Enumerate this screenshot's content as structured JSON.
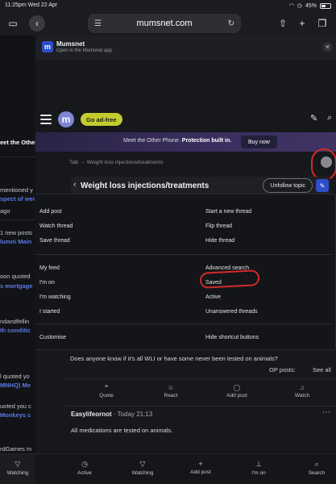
{
  "status_bar": {
    "time_date": "11:25pm  Wed 22 Apr",
    "battery": "45%"
  },
  "browser": {
    "url": "mumsnet.com"
  },
  "left_bg": {
    "fragments": [
      {
        "text": "eet the Other",
        "kind": "plain"
      },
      {
        "text": "mentioned y",
        "kind": "plain"
      },
      {
        "text": "spect of wei",
        "kind": "link"
      },
      {
        "text": "ago",
        "kind": "plain"
      },
      {
        "text": "1 new posts",
        "kind": "plain"
      },
      {
        "text": "lumni Main",
        "kind": "link"
      },
      {
        "text": "oon quoted",
        "kind": "plain"
      },
      {
        "text": "s mortgage",
        "kind": "link"
      },
      {
        "text": "ndandfellin",
        "kind": "plain"
      },
      {
        "text": "th conditic",
        "kind": "link"
      },
      {
        "text": "l quoted yo",
        "kind": "plain"
      },
      {
        "text": "MNHQ) Me",
        "kind": "link"
      },
      {
        "text": "uoted you c",
        "kind": "plain"
      },
      {
        "text": "Monkeys c",
        "kind": "link"
      },
      {
        "text": "rdGames m",
        "kind": "plain"
      }
    ],
    "bottom_label": "Watching"
  },
  "app_banner": {
    "title": "Mumsnet",
    "subtitle": "Open in the Mumsnet app"
  },
  "header": {
    "logo_letter": "m",
    "ad_free_label": "Go ad-free"
  },
  "promo": {
    "left_text": "eet the Other",
    "text": "Meet the Other Phone.",
    "bold_text": "Protection built in.",
    "button": "Buy now"
  },
  "breadcrumb": {
    "root": "Talk",
    "separator": "→",
    "current": "Weight loss injections/treatments"
  },
  "thread": {
    "title": "Weight loss injections/treatments",
    "unfollow_label": "Unfollow topic"
  },
  "menu": {
    "left_col": [
      "Add post",
      "Watch thread",
      "Save thread"
    ],
    "right_col": [
      "Start a new thread",
      "Flip thread",
      "Hide thread"
    ],
    "left_col2": [
      "My feed",
      "I'm on",
      "I'm watching",
      "I started"
    ],
    "right_col2": [
      "Advanced search",
      "Saved",
      "Active",
      "Unanswered threads"
    ],
    "left_col3": [
      "Customise"
    ],
    "right_col3": [
      "Hide shortcut buttons"
    ]
  },
  "post1": {
    "question": "Does anyone know if it's all WLI or have some never been tested on animals?",
    "op_posts_label": "OP posts:",
    "see_all_label": "See all",
    "actions": [
      "Quote",
      "React",
      "Add post",
      "Watch"
    ]
  },
  "post2": {
    "author": "Easylifeornot",
    "time": "· Today 21:13",
    "body": "All medications are tested on animals."
  },
  "bottom_nav": [
    "Active",
    "Watching",
    "Add post",
    "I'm on",
    "Search"
  ]
}
